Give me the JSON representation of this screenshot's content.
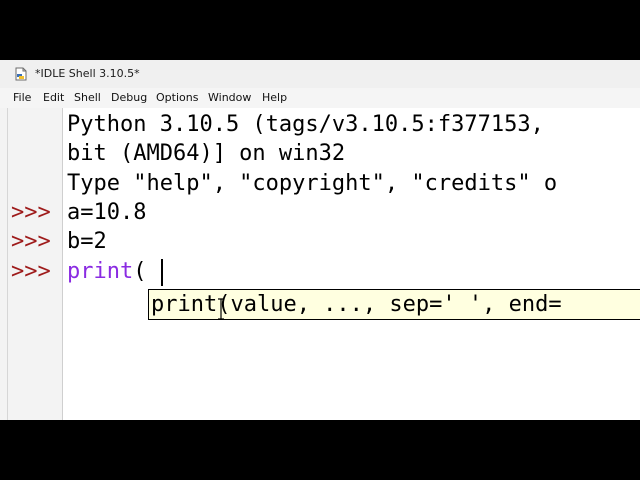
{
  "window": {
    "title": "*IDLE Shell 3.10.5*",
    "icon": "idle-file-icon"
  },
  "menu": [
    "File",
    "Edit",
    "Shell",
    "Debug",
    "Options",
    "Window",
    "Help"
  ],
  "banner": [
    "Python 3.10.5 (tags/v3.10.5:f377153,",
    "bit (AMD64)] on win32",
    "Type \"help\", \"copyright\", \"credits\" o"
  ],
  "prompt": ">>>",
  "commands": {
    "line1": "a=10.8",
    "line2": "b=2",
    "line3_builtin": "print",
    "line3_rest": "("
  },
  "calltip": {
    "text": "print(value, ..., sep=' ', end="
  },
  "colors": {
    "prompt": "#9e1a1a",
    "builtin": "#8a2be2",
    "calltip_bg": "#ffffe0"
  }
}
